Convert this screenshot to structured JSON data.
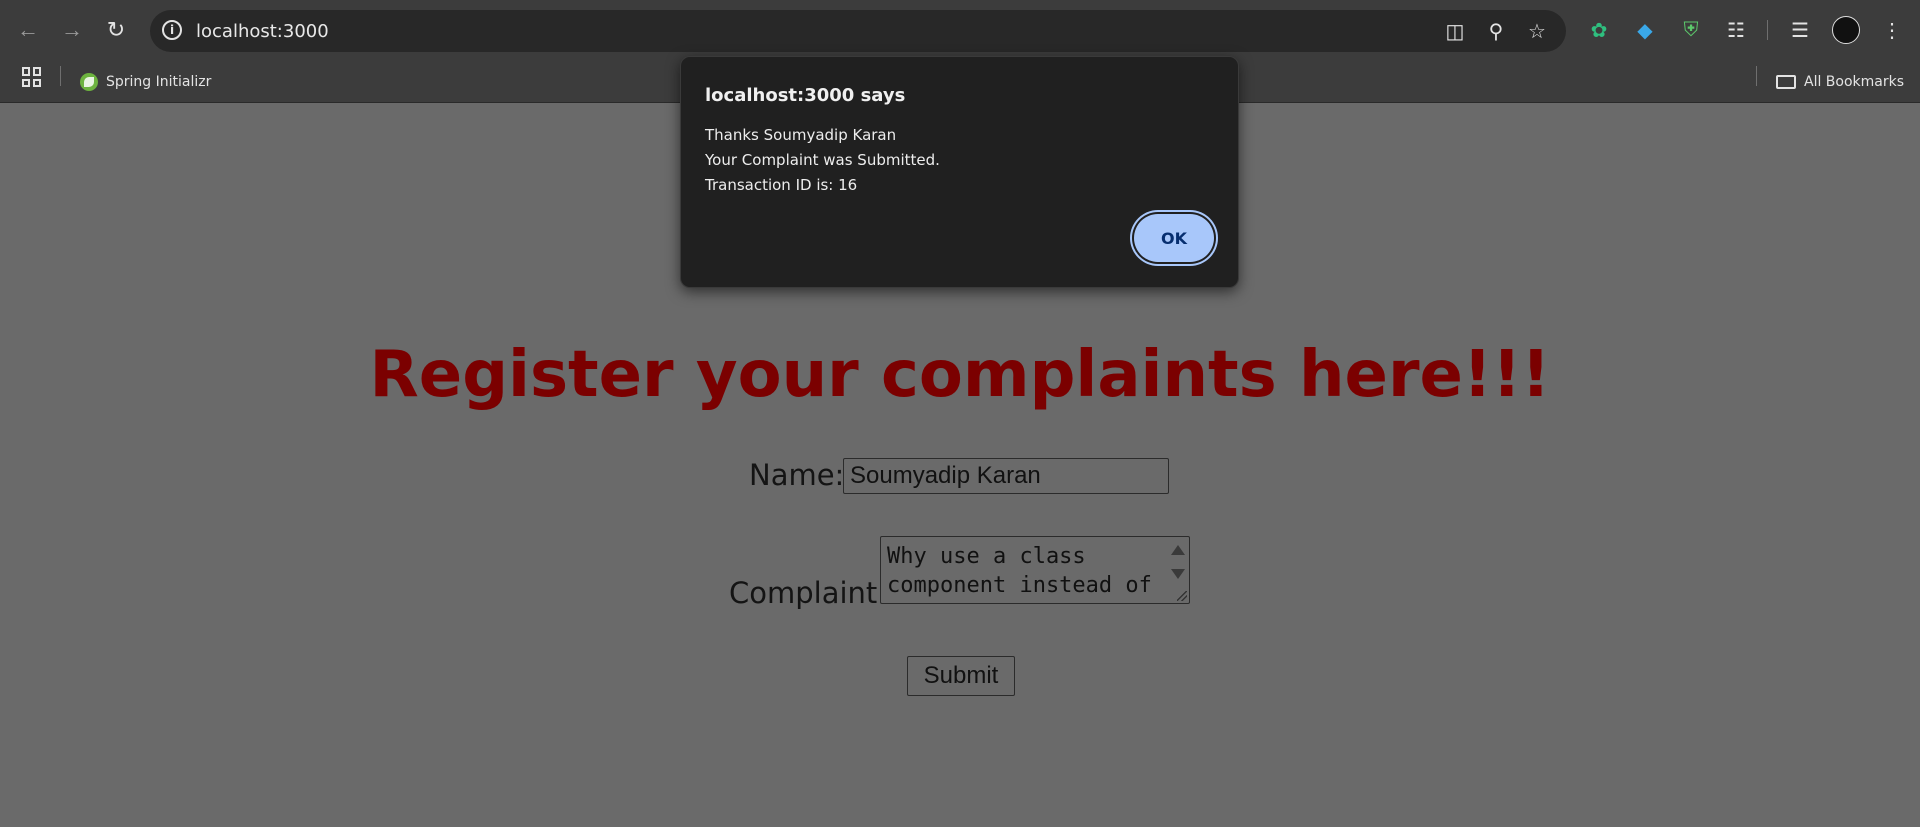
{
  "browser": {
    "url": "localhost:3000",
    "bookmarks": [
      {
        "label": "Spring Initializr"
      }
    ],
    "all_bookmarks_label": "All Bookmarks"
  },
  "dialog": {
    "title": "localhost:3000 says",
    "lines": [
      "Thanks Soumyadip Karan",
      "Your Complaint was Submitted.",
      "Transaction ID is: 16"
    ],
    "ok_label": "OK"
  },
  "page": {
    "title": "Register your complaints here!!!",
    "name_label": "Name:",
    "name_value": "Soumyadip Karan",
    "complaint_label": "Complaint:",
    "complaint_value": "Why use a class\ncomponent instead of",
    "submit_label": "Submit"
  },
  "colors": {
    "title": "#7b0000",
    "ok_button": "#a8c7fa",
    "overlay_page": "#6a6a6a"
  }
}
